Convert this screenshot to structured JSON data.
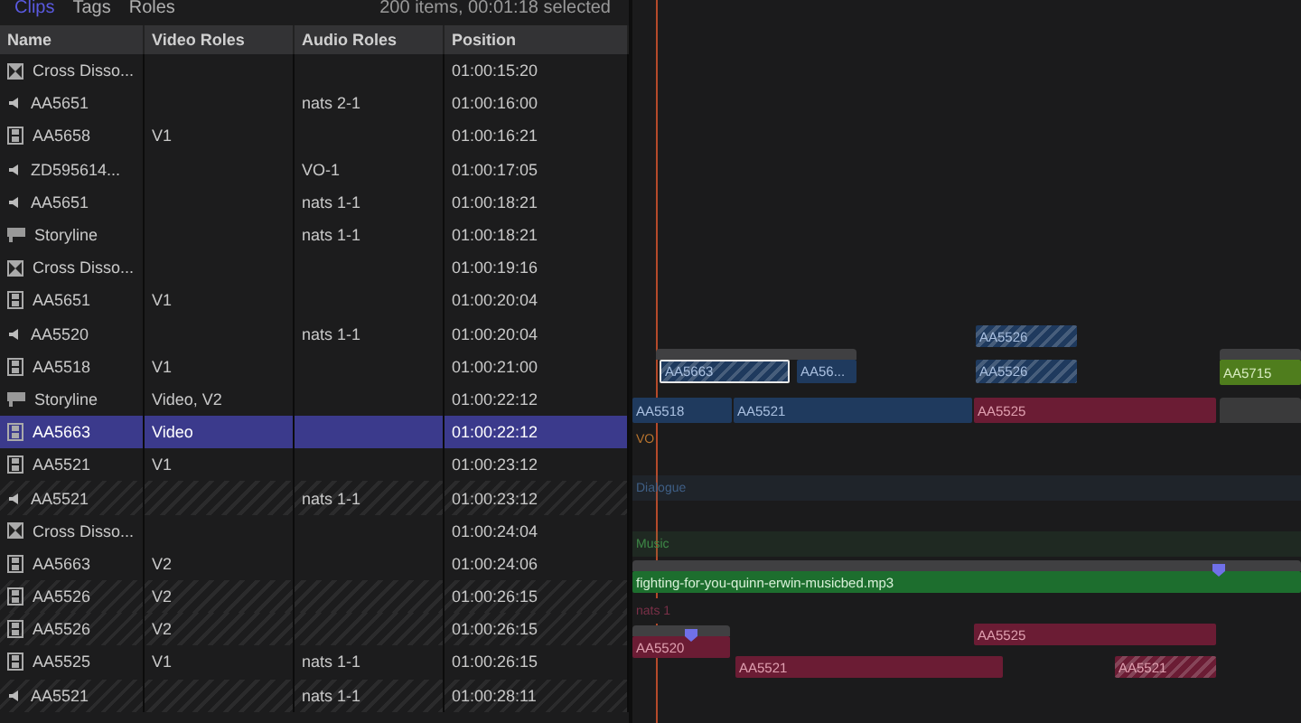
{
  "browser_tabs": [
    {
      "label": "Clips",
      "selected": true
    },
    {
      "label": "Tags",
      "selected": false
    },
    {
      "label": "Roles",
      "selected": false
    }
  ],
  "summary": "200 items, 00:01:18 selected",
  "table": {
    "columns": [
      "Name",
      "Video Roles",
      "Audio Roles",
      "Position"
    ],
    "rows": [
      {
        "kind": "transition",
        "name": "Cross Disso...",
        "video": "",
        "audio": "",
        "position": "01:00:15:20",
        "selected": false,
        "disabled": false
      },
      {
        "kind": "audio",
        "name": "AA5651",
        "video": "",
        "audio": "nats 2-1",
        "position": "01:00:16:00",
        "selected": false,
        "disabled": false
      },
      {
        "kind": "video",
        "name": "AA5658",
        "video": "V1",
        "audio": "",
        "position": "01:00:16:21",
        "selected": false,
        "disabled": false
      },
      {
        "kind": "audio",
        "name": "ZD595614...",
        "video": "",
        "audio": "VO-1",
        "position": "01:00:17:05",
        "selected": false,
        "disabled": false
      },
      {
        "kind": "audio",
        "name": "AA5651",
        "video": "",
        "audio": "nats 1-1",
        "position": "01:00:18:21",
        "selected": false,
        "disabled": false
      },
      {
        "kind": "storyline",
        "name": "Storyline",
        "video": "",
        "audio": "nats 1-1",
        "position": "01:00:18:21",
        "selected": false,
        "disabled": false
      },
      {
        "kind": "transition",
        "name": "Cross Disso...",
        "video": "",
        "audio": "",
        "position": "01:00:19:16",
        "selected": false,
        "disabled": false
      },
      {
        "kind": "video",
        "name": "AA5651",
        "video": "V1",
        "audio": "",
        "position": "01:00:20:04",
        "selected": false,
        "disabled": false
      },
      {
        "kind": "audio",
        "name": "AA5520",
        "video": "",
        "audio": "nats 1-1",
        "position": "01:00:20:04",
        "selected": false,
        "disabled": false
      },
      {
        "kind": "video",
        "name": "AA5518",
        "video": "V1",
        "audio": "",
        "position": "01:00:21:00",
        "selected": false,
        "disabled": false
      },
      {
        "kind": "storyline",
        "name": "Storyline",
        "video": "Video, V2",
        "audio": "",
        "position": "01:00:22:12",
        "selected": false,
        "disabled": false
      },
      {
        "kind": "video",
        "name": "AA5663",
        "video": "Video",
        "audio": "",
        "position": "01:00:22:12",
        "selected": true,
        "disabled": false
      },
      {
        "kind": "video",
        "name": "AA5521",
        "video": "V1",
        "audio": "",
        "position": "01:00:23:12",
        "selected": false,
        "disabled": false
      },
      {
        "kind": "audio",
        "name": "AA5521",
        "video": "",
        "audio": "nats 1-1",
        "position": "01:00:23:12",
        "selected": false,
        "disabled": true
      },
      {
        "kind": "transition",
        "name": "Cross Disso...",
        "video": "",
        "audio": "",
        "position": "01:00:24:04",
        "selected": false,
        "disabled": false
      },
      {
        "kind": "video",
        "name": "AA5663",
        "video": "V2",
        "audio": "",
        "position": "01:00:24:06",
        "selected": false,
        "disabled": false
      },
      {
        "kind": "video",
        "name": "AA5526",
        "video": "V2",
        "audio": "",
        "position": "01:00:26:15",
        "selected": false,
        "disabled": true
      },
      {
        "kind": "video",
        "name": "AA5526",
        "video": "V2",
        "audio": "",
        "position": "01:00:26:15",
        "selected": false,
        "disabled": true
      },
      {
        "kind": "video",
        "name": "AA5525",
        "video": "V1",
        "audio": "nats 1-1",
        "position": "01:00:26:15",
        "selected": false,
        "disabled": false
      },
      {
        "kind": "audio",
        "name": "AA5521",
        "video": "",
        "audio": "nats 1-1",
        "position": "01:00:28:11",
        "selected": false,
        "disabled": true
      }
    ]
  },
  "timeline": {
    "lanes": [
      {
        "label": "VO",
        "color": "#b8742e"
      },
      {
        "label": "Dialogue",
        "color": "#3f5f86"
      },
      {
        "label": "Music",
        "color": "#3f8a48"
      },
      {
        "label": "nats 1",
        "color": "#7a3048"
      }
    ],
    "clips": [
      {
        "kind": "video",
        "label": "AA5526",
        "selected": false,
        "disabled": true
      },
      {
        "kind": "video",
        "label": "AA5663",
        "selected": true,
        "disabled": true
      },
      {
        "kind": "video",
        "label": "AA56...",
        "selected": false,
        "disabled": false
      },
      {
        "kind": "video",
        "label": "AA5526",
        "selected": false,
        "disabled": true
      },
      {
        "kind": "title",
        "label": "AA5715",
        "selected": false,
        "disabled": false
      },
      {
        "kind": "video",
        "label": "AA5518",
        "selected": false,
        "disabled": false
      },
      {
        "kind": "video",
        "label": "AA5521",
        "selected": false,
        "disabled": false
      },
      {
        "kind": "audio",
        "label": "AA5525",
        "selected": false,
        "disabled": false
      },
      {
        "kind": "music",
        "label": "fighting-for-you-quinn-erwin-musicbed.mp3",
        "selected": false,
        "disabled": false
      },
      {
        "kind": "audio",
        "label": "AA5520",
        "selected": false,
        "disabled": false
      },
      {
        "kind": "audio",
        "label": "AA5525",
        "selected": false,
        "disabled": false
      },
      {
        "kind": "audio",
        "label": "AA5521",
        "selected": false,
        "disabled": false
      },
      {
        "kind": "audio",
        "label": "AA5521",
        "selected": false,
        "disabled": true
      }
    ]
  }
}
